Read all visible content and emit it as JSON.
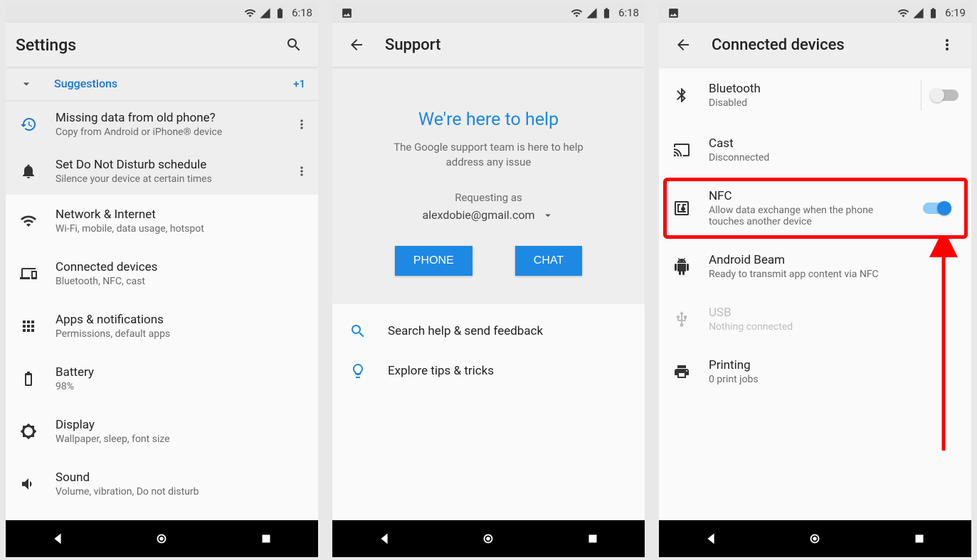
{
  "screen1": {
    "status": {
      "time": "6:18"
    },
    "title": "Settings",
    "suggestions": {
      "label": "Suggestions",
      "badge": "+1"
    },
    "sug_items": [
      {
        "title": "Missing data from old phone?",
        "sub": "Copy from Android or iPhone® device"
      },
      {
        "title": "Set Do Not Disturb schedule",
        "sub": "Silence your device at certain times"
      }
    ],
    "items": [
      {
        "title": "Network & Internet",
        "sub": "Wi-Fi, mobile, data usage, hotspot"
      },
      {
        "title": "Connected devices",
        "sub": "Bluetooth, NFC, cast"
      },
      {
        "title": "Apps & notifications",
        "sub": "Permissions, default apps"
      },
      {
        "title": "Battery",
        "sub": "98%"
      },
      {
        "title": "Display",
        "sub": "Wallpaper, sleep, font size"
      },
      {
        "title": "Sound",
        "sub": "Volume, vibration, Do not disturb"
      }
    ]
  },
  "screen2": {
    "status": {
      "time": "6:18"
    },
    "title": "Support",
    "card": {
      "heading": "We're here to help",
      "sub": "The Google support team is here to help address any issue",
      "requesting": "Requesting as",
      "email": "alexdobie@gmail.com",
      "phone_btn": "PHONE",
      "chat_btn": "CHAT"
    },
    "rows": [
      {
        "label": "Search help & send feedback"
      },
      {
        "label": "Explore tips & tricks"
      }
    ]
  },
  "screen3": {
    "status": {
      "time": "6:19"
    },
    "title": "Connected devices",
    "items": [
      {
        "title": "Bluetooth",
        "sub": "Disabled"
      },
      {
        "title": "Cast",
        "sub": "Disconnected"
      },
      {
        "title": "NFC",
        "sub": "Allow data exchange when the phone touches another device"
      },
      {
        "title": "Android Beam",
        "sub": "Ready to transmit app content via NFC"
      },
      {
        "title": "USB",
        "sub": "Nothing connected"
      },
      {
        "title": "Printing",
        "sub": "0 print jobs"
      }
    ]
  }
}
